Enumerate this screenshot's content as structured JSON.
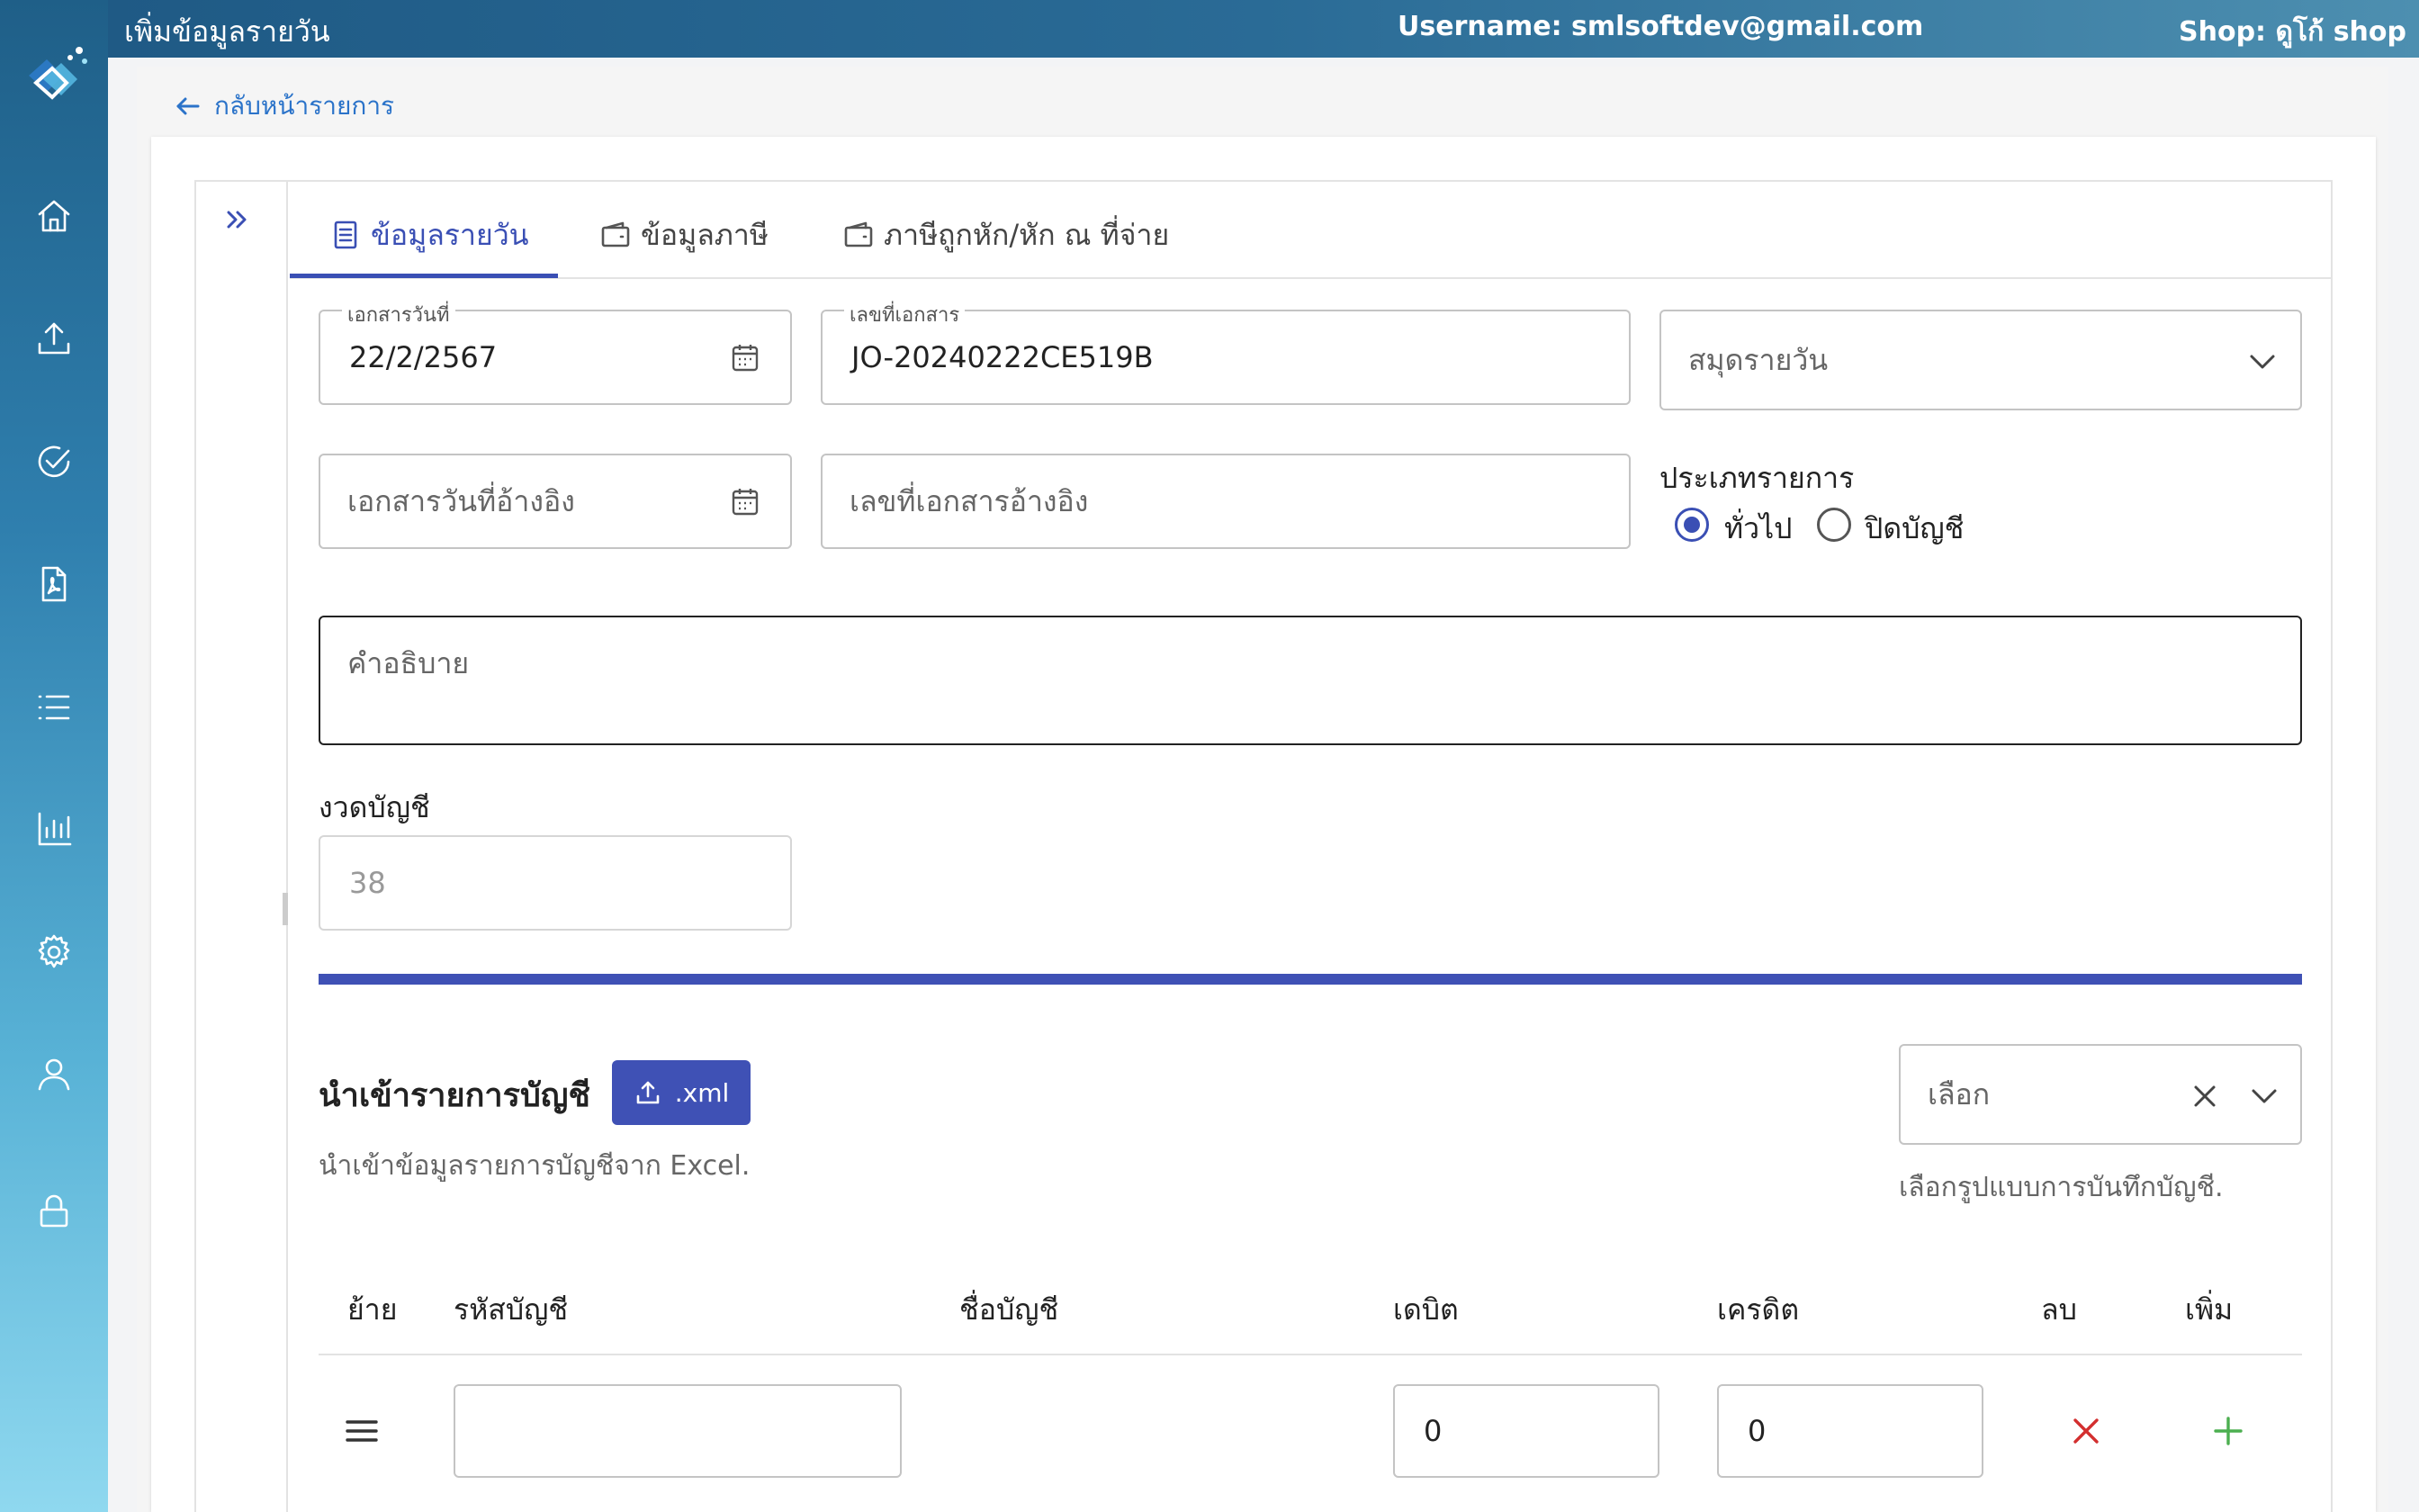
{
  "header": {
    "page_title": "เพิ่มข้อมูลรายวัน",
    "username": "Username: smlsoftdev@gmail.com",
    "shop": "Shop: ดูโก้ shop"
  },
  "sidebar": {
    "items": [
      {
        "icon": "home-icon"
      },
      {
        "icon": "upload-icon"
      },
      {
        "icon": "check-circle-icon"
      },
      {
        "icon": "pdf-file-icon"
      },
      {
        "icon": "list-icon"
      },
      {
        "icon": "bar-chart-icon"
      },
      {
        "icon": "gear-icon"
      },
      {
        "icon": "user-icon"
      },
      {
        "icon": "lock-icon"
      }
    ]
  },
  "back_link": "กลับหน้ารายการ",
  "tabs": [
    {
      "label": "ข้อมูลรายวัน",
      "active": true,
      "icon": "document-icon"
    },
    {
      "label": "ข้อมูลภาษี",
      "active": false,
      "icon": "wallet-icon"
    },
    {
      "label": "ภาษีถูกหัก/หัก ณ ที่จ่าย",
      "active": false,
      "icon": "wallet-icon"
    }
  ],
  "form": {
    "doc_date": {
      "label": "เอกสารวันที่",
      "value": "22/2/2567"
    },
    "doc_no": {
      "label": "เลขที่เอกสาร",
      "value": "JO-20240222CE519B"
    },
    "journal_book": {
      "placeholder": "สมุดรายวัน"
    },
    "ref_date": {
      "placeholder": "เอกสารวันที่อ้างอิง"
    },
    "ref_no": {
      "placeholder": "เลขที่เอกสารอ้างอิง"
    },
    "txn_type": {
      "label": "ประเภทรายการ",
      "options": [
        {
          "label": "ทั่วไป",
          "selected": true
        },
        {
          "label": "ปิดบัญชี",
          "selected": false
        }
      ]
    },
    "description": {
      "placeholder": "คำอธิบาย"
    },
    "period": {
      "label": "งวดบัญชี",
      "value": "38"
    }
  },
  "import_section": {
    "title": "นำเข้ารายการบัญชี",
    "button_label": ".xml",
    "hint": "นำเข้าข้อมูลรายการบัญชีจาก Excel.",
    "format_select": {
      "placeholder": "เลือก",
      "hint": "เลือกรูปแบบการบันทึกบัญชี."
    }
  },
  "table": {
    "headers": [
      "ย้าย",
      "รหัสบัญชี",
      "ชื่อบัญชี",
      "เดบิต",
      "เครดิต",
      "ลบ",
      "เพิ่ม"
    ],
    "rows": [
      {
        "account_code": "",
        "account_name": "",
        "debit": "0",
        "credit": "0"
      }
    ]
  },
  "colors": {
    "accent": "#3f51b5",
    "delete": "#d32f2f",
    "add": "#4caf50"
  }
}
